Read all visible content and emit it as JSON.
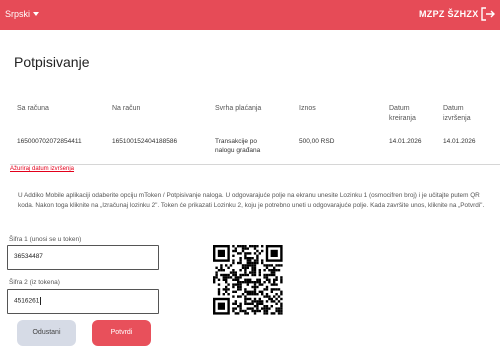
{
  "header": {
    "language": "Srpski",
    "user": "MZPZ ŠZHZX",
    "logout_icon": "logout-icon"
  },
  "page": {
    "title": "Potpisivanje"
  },
  "table": {
    "columns": [
      "Sa računa",
      "Na račun",
      "Svrha plaćanja",
      "Iznos",
      "Datum kreiranja",
      "Datum izvršenja"
    ],
    "row": {
      "from_account": "165000702072854411",
      "to_account": "165100152404188586",
      "purpose": "Transakcije po nalogu građana",
      "amount": "500,00 RSD",
      "created": "14.01.2026",
      "executed": "14.01.2026"
    }
  },
  "update_link": "Ažuriraj datum izvršenja",
  "instructions": "U Addiko Mobile aplikaciji odaberite opciju mToken / Potpisivanje naloga. U odgovarajuće polje na ekranu unesite Lozinku 1 (osmocifren broj) i je učitajte putem QR koda. Nakon toga kliknite na „Izračunaj lozinku 2\". Token će prikazati Lozinku 2, koju je potrebno uneti u odgovarajuće polje. Kada završite unos, kliknite na „Potvrdi\".",
  "form": {
    "field1_label": "Šifra 1 (unosi se u token)",
    "field1_value": "36534487",
    "field2_label": "Šifra 2 (iz tokena)",
    "field2_value": "4516261"
  },
  "buttons": {
    "cancel": "Odustani",
    "confirm": "Potvrdi"
  },
  "colors": {
    "brand": "#e64b57",
    "link": "#e3001b",
    "cancel_bg": "#d6dbe6"
  }
}
